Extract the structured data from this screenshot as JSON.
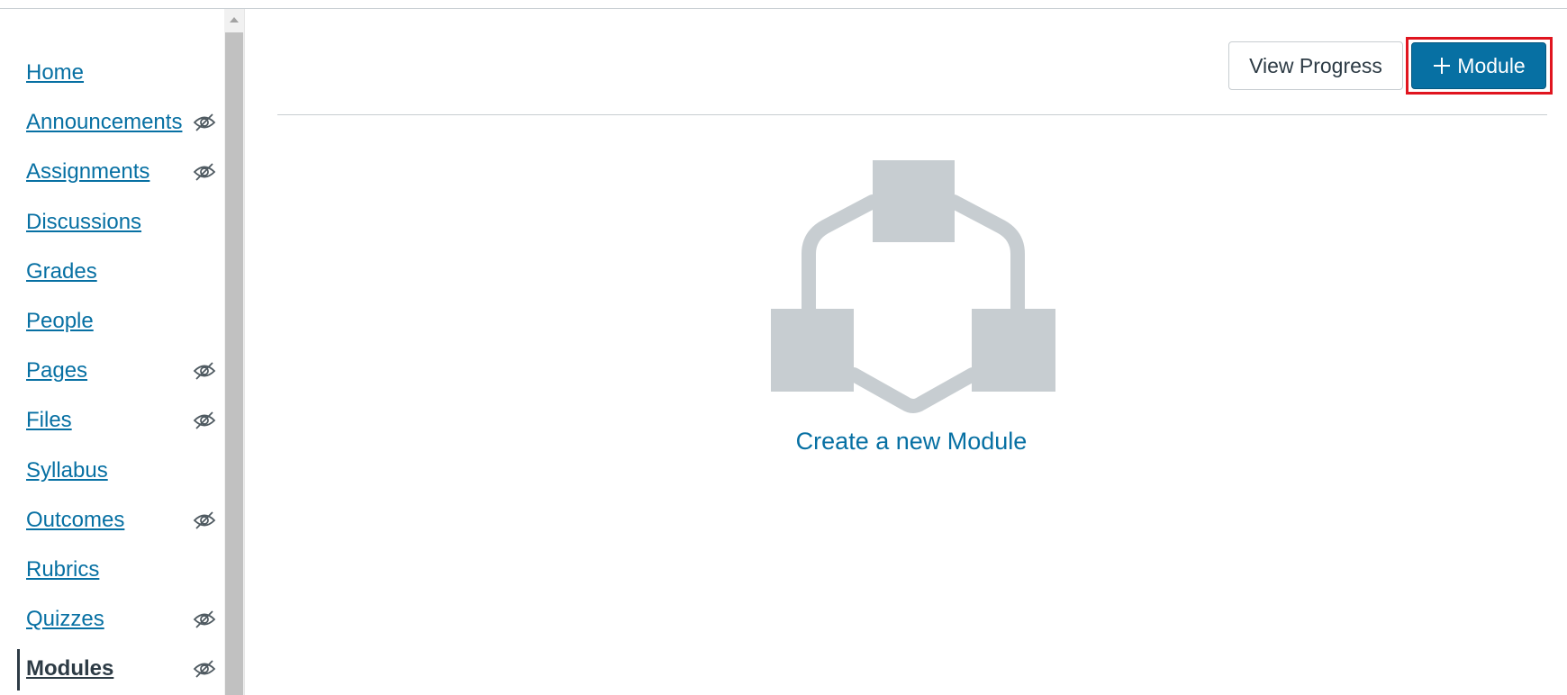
{
  "sidebar": {
    "items": [
      {
        "label": "Home",
        "hidden": false,
        "active": false
      },
      {
        "label": "Announcements",
        "hidden": true,
        "active": false
      },
      {
        "label": "Assignments",
        "hidden": true,
        "active": false
      },
      {
        "label": "Discussions",
        "hidden": false,
        "active": false
      },
      {
        "label": "Grades",
        "hidden": false,
        "active": false
      },
      {
        "label": "People",
        "hidden": false,
        "active": false
      },
      {
        "label": "Pages",
        "hidden": true,
        "active": false
      },
      {
        "label": "Files",
        "hidden": true,
        "active": false
      },
      {
        "label": "Syllabus",
        "hidden": false,
        "active": false
      },
      {
        "label": "Outcomes",
        "hidden": true,
        "active": false
      },
      {
        "label": "Rubrics",
        "hidden": false,
        "active": false
      },
      {
        "label": "Quizzes",
        "hidden": true,
        "active": false
      },
      {
        "label": "Modules",
        "hidden": true,
        "active": true
      }
    ],
    "hidden_icon": "eye-slash-icon"
  },
  "header": {
    "view_progress_label": "View Progress",
    "add_module_label": "Module",
    "add_module_icon": "plus-icon"
  },
  "empty_state": {
    "illustration_icon": "modules-illustration-icon",
    "create_link_label": "Create a new Module"
  },
  "colors": {
    "link": "#0770a3",
    "primary_button": "#0770a3",
    "highlight": "#e0151f",
    "illustration": "#c7cdd1",
    "active_text": "#2d3b45"
  }
}
